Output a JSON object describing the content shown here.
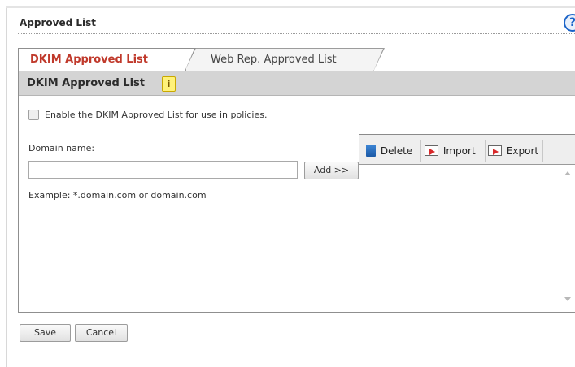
{
  "page": {
    "title": "Approved List",
    "help_icon": "help-icon",
    "help_glyph": "?"
  },
  "tabs": [
    {
      "label": "DKIM Approved List",
      "active": true
    },
    {
      "label": "Web Rep. Approved List",
      "active": false
    }
  ],
  "section": {
    "title": "DKIM Approved List",
    "info_glyph": "i"
  },
  "enable": {
    "label": "Enable the DKIM Approved List for use in policies.",
    "checked": false
  },
  "domain": {
    "label": "Domain name:",
    "value": "",
    "add_label": "Add >>",
    "example": "Example: *.domain.com or domain.com"
  },
  "list_toolbar": {
    "delete_label": "Delete",
    "import_label": "Import",
    "export_label": "Export"
  },
  "list_items": [],
  "footer": {
    "save_label": "Save",
    "cancel_label": "Cancel"
  },
  "colors": {
    "active_tab_text": "#c0392b",
    "section_header_bg": "#d4d4d4",
    "help_icon": "#1a63c8"
  }
}
